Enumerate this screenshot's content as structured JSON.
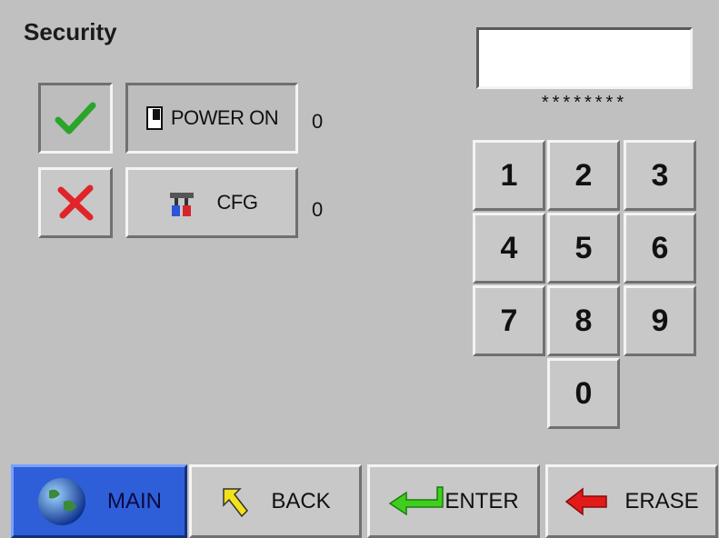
{
  "page": {
    "title": "Security"
  },
  "permissions": [
    {
      "label": "POWER ON",
      "count": "0",
      "icon": "power-switch-icon"
    },
    {
      "label": "CFG",
      "count": "0",
      "icon": "tools-icon"
    }
  ],
  "status_icons": {
    "accept": "checkmark-icon",
    "reject": "x-mark-icon"
  },
  "password": {
    "value": "",
    "mask": "********"
  },
  "keypad": {
    "keys": [
      "1",
      "2",
      "3",
      "4",
      "5",
      "6",
      "7",
      "8",
      "9",
      "0"
    ]
  },
  "nav": {
    "main": "MAIN",
    "back": "BACK",
    "enter": "ENTER",
    "erase": "ERASE"
  },
  "colors": {
    "background": "#c0c0c0",
    "check": "#2aa52a",
    "cross": "#e0242a",
    "enter_arrow": "#3ecf1e",
    "erase_arrow": "#e21a1a",
    "back_arrow": "#f2e21a",
    "main_button": "#2e5fd8"
  }
}
